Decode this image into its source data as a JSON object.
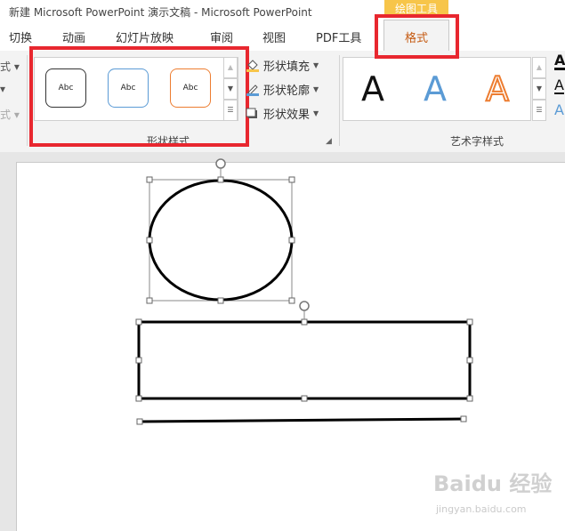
{
  "window": {
    "title": "新建 Microsoft PowerPoint 演示文稿 - Microsoft PowerPoint",
    "context_tab_group": "绘图工具"
  },
  "tabs": [
    {
      "label": "切换"
    },
    {
      "label": "动画"
    },
    {
      "label": "幻灯片放映"
    },
    {
      "label": "审阅"
    },
    {
      "label": "视图"
    },
    {
      "label": "PDF工具"
    },
    {
      "label": "格式",
      "active": true
    }
  ],
  "ribbon": {
    "left_stub": [
      "式 ▾",
      "▾",
      "式 ▾"
    ],
    "shape_styles": {
      "group_label": "形状样式",
      "thumbs": [
        {
          "label": "Abc",
          "border": "#333333"
        },
        {
          "label": "Abc",
          "border": "#5b9bd5"
        },
        {
          "label": "Abc",
          "border": "#ed7d31"
        }
      ]
    },
    "shape_commands": [
      {
        "label": "形状填充",
        "icon": "paint-bucket-icon"
      },
      {
        "label": "形状轮廓",
        "icon": "pen-outline-icon"
      },
      {
        "label": "形状效果",
        "icon": "shape-effects-icon"
      }
    ],
    "wordart_styles": {
      "group_label": "艺术字样式",
      "items": [
        {
          "glyph": "A",
          "color": "#111111",
          "style": "solid"
        },
        {
          "glyph": "A",
          "color": "#5b9bd5",
          "style": "gradient"
        },
        {
          "glyph": "A",
          "color": "#ed7d31",
          "style": "outline"
        }
      ]
    },
    "text_stub": [
      "A",
      "A",
      "A"
    ]
  },
  "watermark": {
    "text": "Baidu 经验",
    "sub": "jingyan.baidu.com"
  },
  "colors": {
    "highlight": "#e8272f",
    "active_tab_text": "#c55a11",
    "context_tab_bg": "#f7c54a"
  }
}
